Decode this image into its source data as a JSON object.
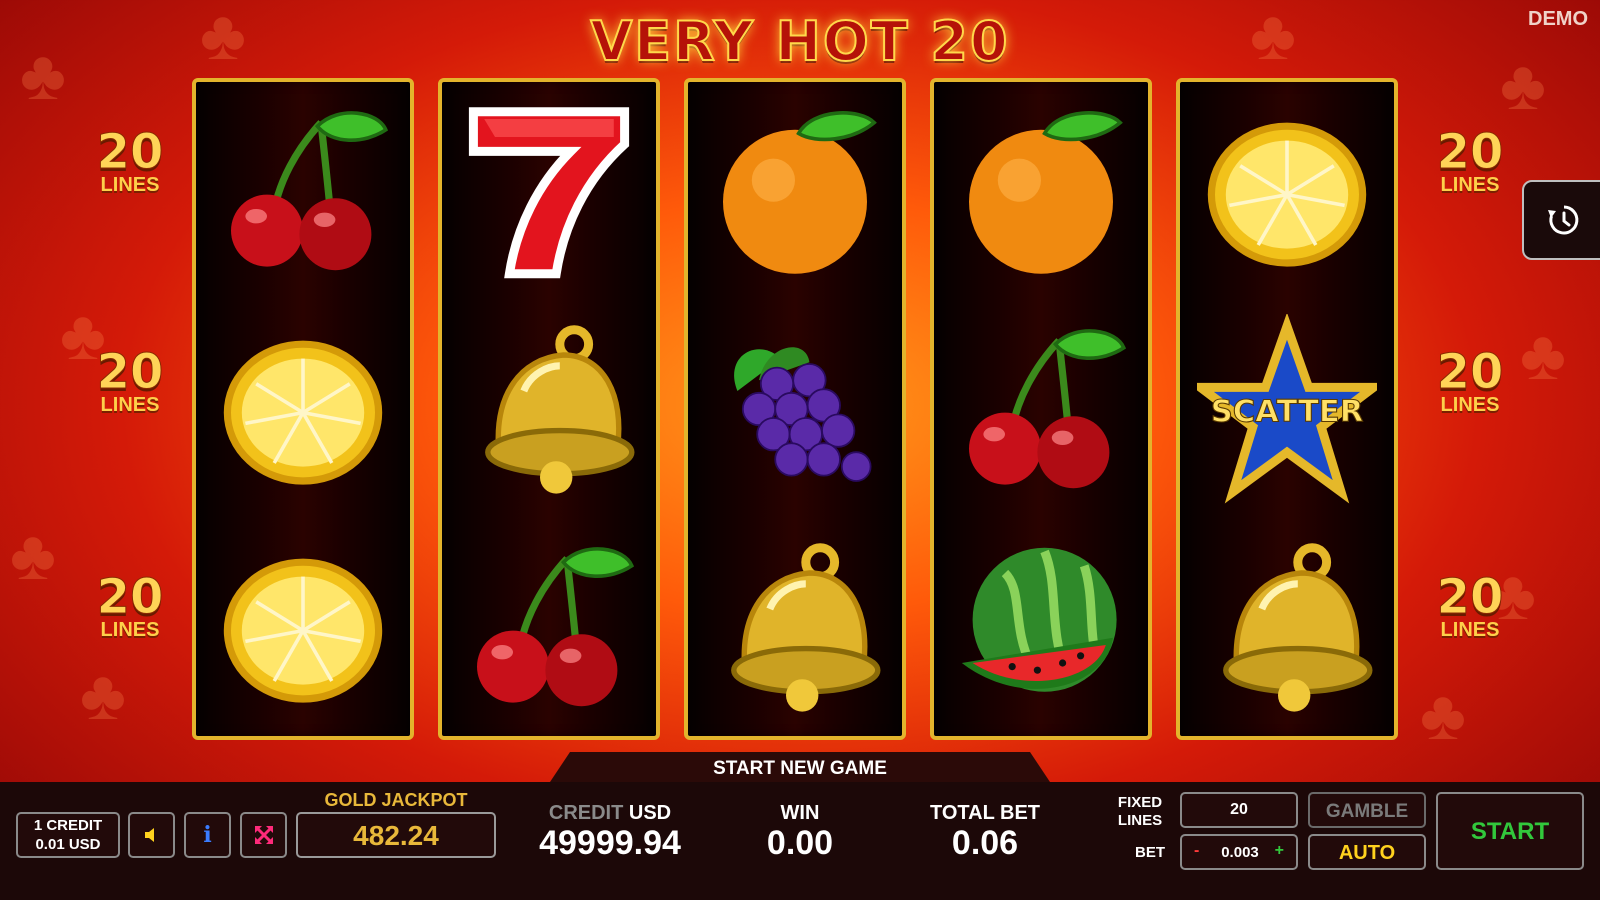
{
  "header": {
    "title": "VERY HOT 20",
    "mode_badge": "DEMO"
  },
  "paylines": {
    "left": [
      {
        "value": "20",
        "label": "LINES"
      },
      {
        "value": "20",
        "label": "LINES"
      },
      {
        "value": "20",
        "label": "LINES"
      }
    ],
    "right": [
      {
        "value": "20",
        "label": "LINES"
      },
      {
        "value": "20",
        "label": "LINES"
      },
      {
        "value": "20",
        "label": "LINES"
      }
    ]
  },
  "reels": [
    [
      "cherry",
      "lemon",
      "lemon"
    ],
    [
      "seven",
      "bell",
      "cherry"
    ],
    [
      "orange",
      "grapes",
      "bell"
    ],
    [
      "orange",
      "cherry",
      "watermelon"
    ],
    [
      "lemon",
      "scatter",
      "bell"
    ]
  ],
  "symbols": {
    "scatter_label": "SCATTER",
    "seven_label": "7"
  },
  "history_button": {
    "icon": "history-icon"
  },
  "status": {
    "message": "START NEW GAME"
  },
  "panel": {
    "credit_value": {
      "line1": "1 CREDIT",
      "line2": "0.01 USD"
    },
    "sound_icon": "speaker-icon",
    "info_icon": "info-icon",
    "fullscreen_icon": "fullscreen-icon",
    "jackpot": {
      "label": "GOLD JACKPOT",
      "value": "482.24"
    },
    "credit": {
      "label_main": "CREDIT",
      "label_currency": "USD",
      "value": "49999.94"
    },
    "win": {
      "label": "WIN",
      "value": "0.00"
    },
    "total_bet": {
      "label": "TOTAL BET",
      "value": "0.06"
    },
    "fixed_lines": {
      "label_line1": "FIXED",
      "label_line2": "LINES",
      "value": "20"
    },
    "bet": {
      "label": "BET",
      "minus": "-",
      "value": "0.003",
      "plus": "+"
    },
    "gamble_label": "GAMBLE",
    "auto_label": "AUTO",
    "start_label": "START"
  },
  "colors": {
    "start_green": "#32c83c",
    "auto_yellow": "#ffd21e",
    "jackpot_gold": "#e8b83a",
    "fullscreen_pink": "#ff2a7a"
  }
}
